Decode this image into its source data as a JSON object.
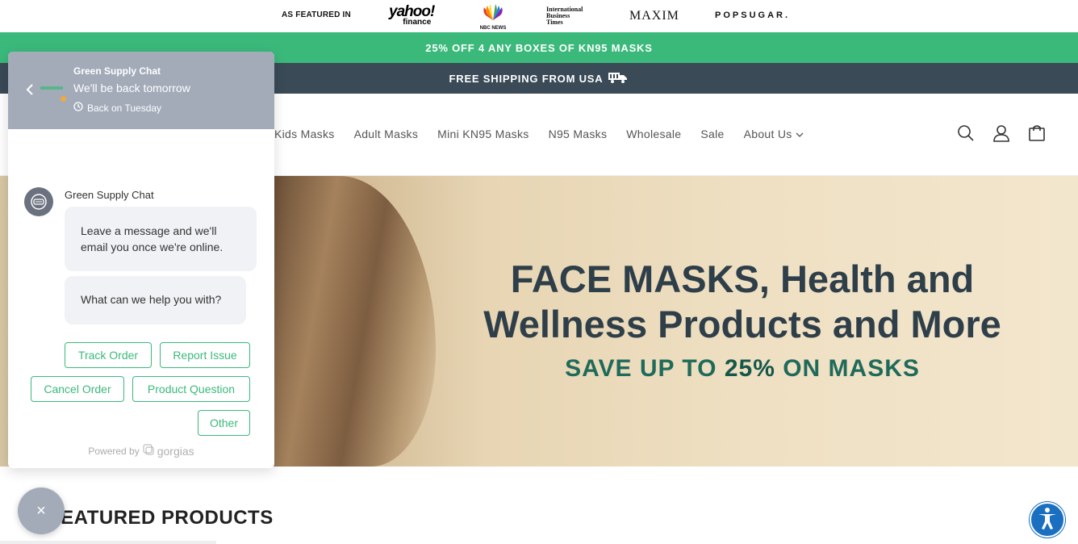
{
  "featured": {
    "label": "AS FEATURED IN",
    "logos": [
      "yahoo!",
      "finance",
      "NBC NEWS",
      "International",
      "Business",
      "Times",
      "MAXIM",
      "POPSUGAR."
    ]
  },
  "promo": {
    "text": "25% OFF 4 ANY BOXES OF KN95 MASKS",
    "color": "#3bb97b"
  },
  "shipping": {
    "text": "FREE SHIPPING FROM USA",
    "icon": "truck-icon",
    "color": "#3a4a57"
  },
  "nav": {
    "items": [
      "Kids Masks",
      "Adult Masks",
      "Mini KN95 Masks",
      "N95 Masks",
      "Wholesale",
      "Sale",
      "About Us"
    ]
  },
  "header_icons": [
    "search-icon",
    "account-icon",
    "cart-icon"
  ],
  "hero": {
    "title_line1": "FACE MASKS, Health and",
    "title_line2": "Wellness Products and More",
    "sub_pre": "SAVE UP TO ",
    "sub_bold": "25%",
    "sub_post": " ON MASKS"
  },
  "featured_products": {
    "title": "FEATURED PRODUCTS"
  },
  "chat": {
    "name": "Green Supply Chat",
    "status": "We'll be back tomorrow",
    "back_on": "Back on Tuesday",
    "agent_name": "Green Supply Chat",
    "message1": "Leave a message and we'll email you once we're online.",
    "message2": "What can we help you with?",
    "quick_replies": [
      "Track Order",
      "Report Issue",
      "Cancel Order",
      "Product Question",
      "Other"
    ],
    "powered_by": "Powered by",
    "powered_brand": "gorgias",
    "close_symbol": "×"
  },
  "colors": {
    "accent_green": "#3bb97b",
    "dark_slate": "#3a4a57",
    "chat_header": "#a3abb9",
    "a11y_blue": "#1a6fc1"
  }
}
